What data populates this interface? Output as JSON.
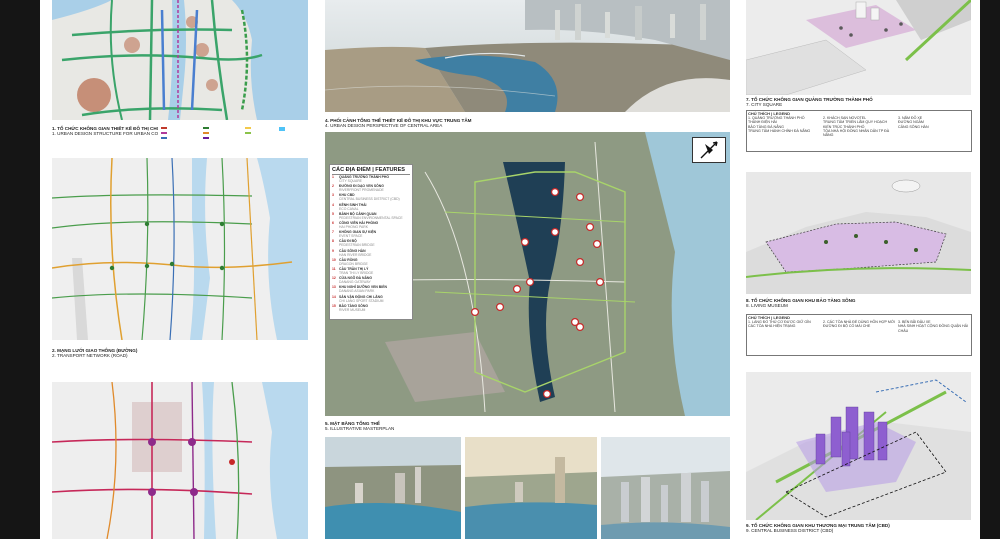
{
  "colors": {
    "water": "#b9d9ee",
    "sea": "#9fc8e4",
    "road_green": "#4a9d4c",
    "road_red": "#c0392b",
    "road_blue": "#3a6fb5",
    "road_orange": "#e08a2b",
    "cbd_purple": "#8e5fd0",
    "river_dark": "#1f3f55"
  },
  "left": {
    "p1": {
      "num": "1.",
      "title": "TỔ CHỨC KHÔNG GIAN THIẾT KẾ ĐÔ THỊ CHO KHU TRUNG TÂM",
      "num_en": "1.",
      "title_en": "URBAN DESIGN STRUCTURE FOR URBAN CORE"
    },
    "p2": {
      "num": "2.",
      "title": "MẠNG LƯỚI GIAO THÔNG (ĐƯỜNG)",
      "num_en": "2.",
      "title_en": "TRANSPORT NETWORK (ROAD)"
    }
  },
  "center": {
    "top": {
      "num": "4.",
      "title": "PHỐI CẢNH TỔNG THỂ THIẾT KẾ ĐÔ THỊ KHU VỰC TRUNG TÂM",
      "num_en": "4.",
      "title_en": "URBAN DESIGN PERSPECTIVE OF CENTRAL AREA"
    },
    "plan": {
      "num": "5.",
      "title": "MẶT BẰNG TỔNG THỂ",
      "num_en": "5.",
      "title_en": "ILLUSTRATIVE MASTERPLAN",
      "features_title": "CÁC ĐỊA ĐIỂM | FEATURES",
      "features": [
        {
          "n": "1",
          "vi": "QUẢNG TRƯỜNG THÀNH PHỐ",
          "en": "CITY SQUARE"
        },
        {
          "n": "2",
          "vi": "ĐƯỜNG ĐI DẠO VEN SÔNG",
          "en": "RIVERFRONT PROMENADE"
        },
        {
          "n": "3",
          "vi": "KHU CBD",
          "en": "CENTRAL BUSINESS DISTRICT (CBD)"
        },
        {
          "n": "4",
          "vi": "KÊNH SINH THÁI",
          "en": "ECO CANAL"
        },
        {
          "n": "5",
          "vi": "BẢNH BỘ CẢNH QUAN",
          "en": "PEDESTRIAN ENVIRONMENTAL SPACE"
        },
        {
          "n": "6",
          "vi": "CÔNG VIÊN HẢI PHÒNG",
          "en": "HAI PHONG PARK"
        },
        {
          "n": "7",
          "vi": "KHÔNG GIAN SỰ KIỆN",
          "en": "EVENT SPACE"
        },
        {
          "n": "8",
          "vi": "CẦU ĐI BỘ",
          "en": "PEDESTRIAN BRIDGE"
        },
        {
          "n": "9",
          "vi": "CẦU SÔNG HÀN",
          "en": "HAN RIVER BRIDGE"
        },
        {
          "n": "10",
          "vi": "CẦU RỒNG",
          "en": "DRAGON BRIDGE"
        },
        {
          "n": "11",
          "vi": "CẦU TRẦN THỊ LÝ",
          "en": "TRAN THI LY BRIDGE"
        },
        {
          "n": "12",
          "vi": "CỬA NGÕ ĐÀ NẴNG",
          "en": "DANANG GATEWAY"
        },
        {
          "n": "13",
          "vi": "KHU NGHỈ DƯỠNG VEN BIỂN",
          "en": "DANANG ASIAN PARK"
        },
        {
          "n": "14",
          "vi": "SÂN VẬN ĐỘNG CHI LĂNG",
          "en": "CHI LANG SPORT STADIUM"
        },
        {
          "n": "15",
          "vi": "BẢO TÀNG SÔNG",
          "en": "RIVER MUSEUM"
        }
      ]
    }
  },
  "right": {
    "p7": {
      "num": "7.",
      "title": "TỔ CHỨC KHÔNG GIAN QUẢNG TRƯỜNG THÀNH PHỐ",
      "num_en": "7.",
      "title_en": "CITY SQUARE",
      "legend_title": "CHÚ THÍCH | LEGEND",
      "legend": [
        "1. QUẢNG TRƯỜNG THÀNH PHỐ",
        "2. KHÁCH SẠN NOVOTEL",
        "3. NĂM ĐỖ XE",
        "THÀNH ĐIỆN HẢI",
        "TRUNG TÂM TRIỂN LÃM QUY HOẠCH",
        "ĐƯỜNG NGẦM",
        "BẢO TÀNG ĐÀ NẴNG",
        "KIẾN TRÚC THÀNH PHỐ",
        "CẢNG SÔNG HÀN",
        "TRUNG TÂM HÀNH CHÍNH ĐÀ NẴNG",
        "TÒA NHÀ HỘI ĐỒNG NHÂN DÂN TP ĐÀ NẴNG"
      ]
    },
    "p8": {
      "num": "8.",
      "title": "TỔ CHỨC KHÔNG GIAN KHU BẢO TÀNG SÔNG",
      "num_en": "8.",
      "title_en": "LIVING MUSEUM",
      "legend_title": "CHÚ THÍCH | LEGEND",
      "legend": [
        "1. LÀNG ĐỔ THỦ CƠ ĐƯỢC GIỮ GÌN",
        "2. CÁC TÒA NHÀ ĐỂ DÙNG HỖN HỢP MỚI",
        "3. BẾN BÃI ĐẬU XE",
        "CÁC TÒA NHÀ HIỆN TRẠNG",
        "ĐƯỜNG ĐI BỘ CÓ MÁI CHE",
        "NHÀ SINH HOẠT CỘNG ĐỒNG QUẬN HẢI CHÂU"
      ]
    },
    "p9": {
      "num": "9.",
      "title": "TỔ CHỨC KHÔNG GIAN KHU THƯƠNG MẠI TRUNG TÂM (CBD)",
      "num_en": "9.",
      "title_en": "CENTRAL BUSINESS DISTRICT (CBD)"
    }
  }
}
